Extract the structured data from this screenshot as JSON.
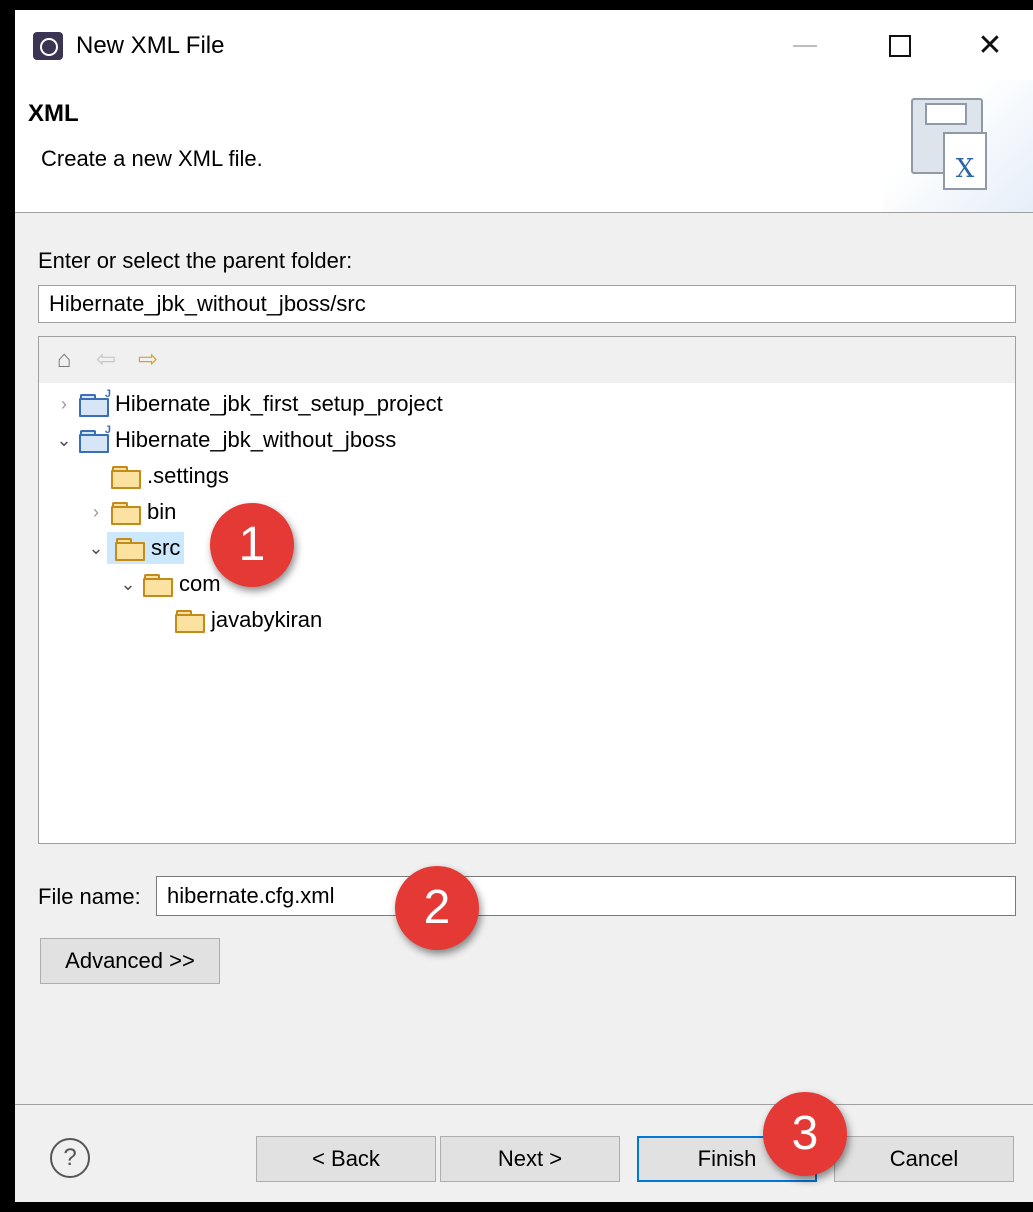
{
  "window": {
    "title": "New XML File",
    "icon": "eclipse-icon"
  },
  "header": {
    "title": "XML",
    "description": "Create a new XML file."
  },
  "parent_folder": {
    "label": "Enter or select the parent folder:",
    "value": "Hibernate_jbk_without_jboss/src"
  },
  "tree": {
    "toolbar": {
      "home": "home-icon",
      "back": "back-arrow-icon",
      "forward": "forward-arrow-icon"
    },
    "items": [
      {
        "label": "Hibernate_jbk_first_setup_project",
        "type": "project",
        "expanded": false
      },
      {
        "label": "Hibernate_jbk_without_jboss",
        "type": "project",
        "expanded": true
      },
      {
        "label": ".settings",
        "type": "folder"
      },
      {
        "label": "bin",
        "type": "folder",
        "expanded": false
      },
      {
        "label": "src",
        "type": "folder",
        "expanded": true,
        "selected": true
      },
      {
        "label": "com",
        "type": "folder",
        "expanded": true
      },
      {
        "label": "javabykiran",
        "type": "folder"
      }
    ]
  },
  "file_name": {
    "label": "File name:",
    "value": "hibernate.cfg.xml"
  },
  "buttons": {
    "advanced": "Advanced >>",
    "back": "< Back",
    "next": "Next >",
    "finish": "Finish",
    "cancel": "Cancel",
    "help": "?"
  },
  "markers": [
    "1",
    "2",
    "3"
  ],
  "colors": {
    "marker": "#e53935",
    "selection": "#cce8ff",
    "focus": "#0078d7"
  }
}
